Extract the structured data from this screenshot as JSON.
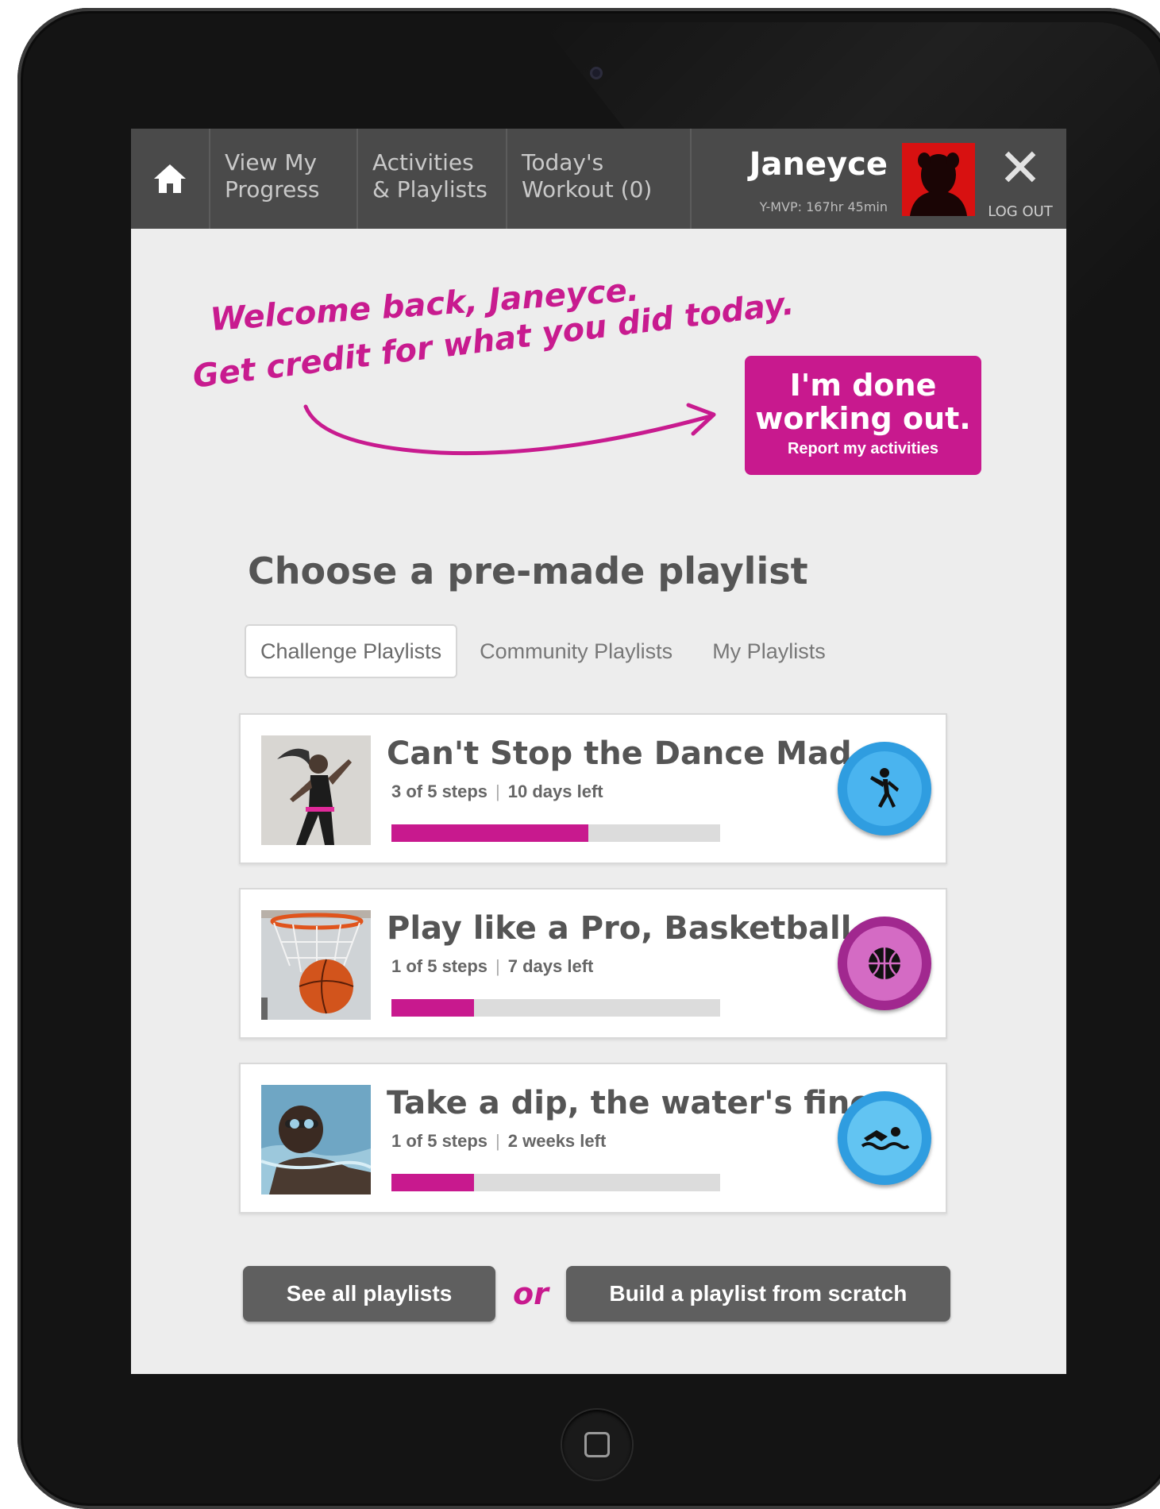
{
  "nav": {
    "progress": [
      "View My",
      "Progress"
    ],
    "activities": [
      "Activities",
      "& Playlists"
    ],
    "workout": [
      "Today's",
      "Workout (0)"
    ],
    "user_name": "Janeyce",
    "user_stat": "Y-MVP: 167hr 45min",
    "logout_label": "LOG OUT"
  },
  "welcome": {
    "line1": "Welcome back, Janeyce.",
    "line2": "Get credit for what you did today."
  },
  "done_button": {
    "title_line1": "I'm done",
    "title_line2": "working out.",
    "subtitle": "Report my activities"
  },
  "section_title": "Choose a pre-made playlist",
  "tabs": [
    {
      "label": "Challenge Playlists",
      "active": true
    },
    {
      "label": "Community Playlists",
      "active": false
    },
    {
      "label": "My Playlists",
      "active": false
    }
  ],
  "playlists": [
    {
      "title": "Can't Stop the Dance Mad...",
      "steps": "3 of 5 steps",
      "time_left": "10 days left",
      "progress": 0.6,
      "icon": "dance-icon",
      "badge_color": "#2f9de0",
      "badge_inner": "#4ab4ef"
    },
    {
      "title": "Play like a Pro, Basketball",
      "steps": "1 of 5 steps",
      "time_left": "7 days left",
      "progress": 0.25,
      "icon": "basketball-icon",
      "badge_color": "#a1288f",
      "badge_inner": "#d46bc4"
    },
    {
      "title": "Take a dip, the water's fine.",
      "steps": "1 of 5 steps",
      "time_left": "2 weeks left",
      "progress": 0.25,
      "icon": "swimming-icon",
      "badge_color": "#2f9de0",
      "badge_inner": "#62c4f2"
    }
  ],
  "bottom": {
    "see_all": "See all playlists",
    "or": "or",
    "build": "Build a playlist from scratch"
  },
  "colors": {
    "accent": "#c8198e",
    "nav_bg": "#4a4a4a"
  }
}
